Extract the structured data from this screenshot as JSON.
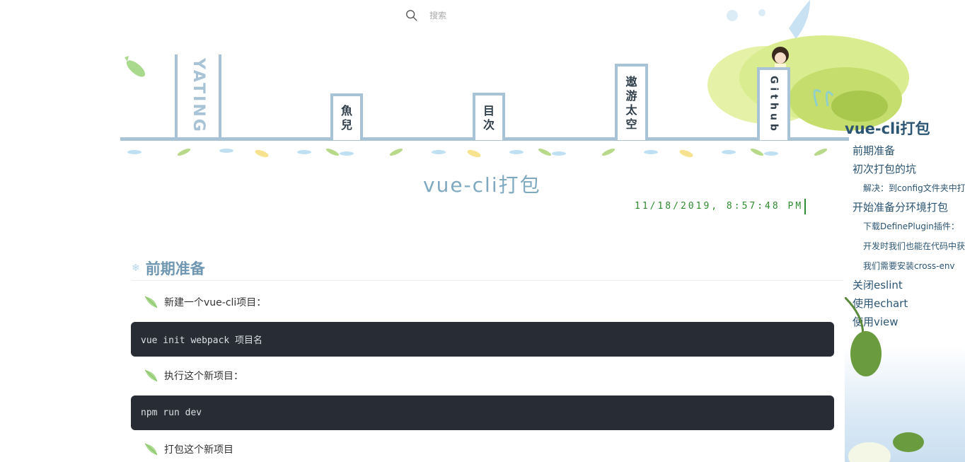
{
  "search": {
    "placeholder": "搜索"
  },
  "nav": {
    "brand": "YATING",
    "items": [
      {
        "label_chars": [
          "魚",
          "兒"
        ]
      },
      {
        "label_chars": [
          "目",
          "次"
        ]
      },
      {
        "label_chars": [
          "遨",
          "游",
          "太",
          "空"
        ]
      },
      {
        "label": "Github"
      }
    ]
  },
  "article": {
    "title": "vue-cli打包",
    "datetime": "11/18/2019, 8:57:48 PM",
    "section_heading": "前期准备",
    "paragraphs": [
      "新建一个vue-cli项目：",
      "执行这个新项目：",
      "打包这个新项目"
    ],
    "code_blocks": [
      "vue init webpack 项目名",
      "npm run dev"
    ]
  },
  "toc": {
    "title": "vue-cli打包",
    "items": [
      {
        "label": "前期准备",
        "level": 1
      },
      {
        "label": "初次打包的坑",
        "level": 1
      },
      {
        "label": "解决：到config文件夹中打",
        "level": 2
      },
      {
        "label": "开始准备分环境打包",
        "level": 1
      },
      {
        "label": "下载DefinePlugin插件：",
        "level": 2
      },
      {
        "label": "开发时我们也能在代码中获",
        "level": 2
      },
      {
        "label": "我们需要安装cross-env",
        "level": 2
      },
      {
        "label": "关闭eslint",
        "level": 1
      },
      {
        "label": "使用echart",
        "level": 1
      },
      {
        "label": "使用view",
        "level": 1
      }
    ]
  },
  "colors": {
    "nav_border": "#a8c3d6",
    "title": "#7ea9c0",
    "time": "#2e8b2e",
    "code_bg": "#282c34",
    "toc_link": "#2c5573"
  },
  "icons": [
    "search-icon",
    "leaf-bullet-icon",
    "snowflake-icon",
    "fish-icon"
  ]
}
